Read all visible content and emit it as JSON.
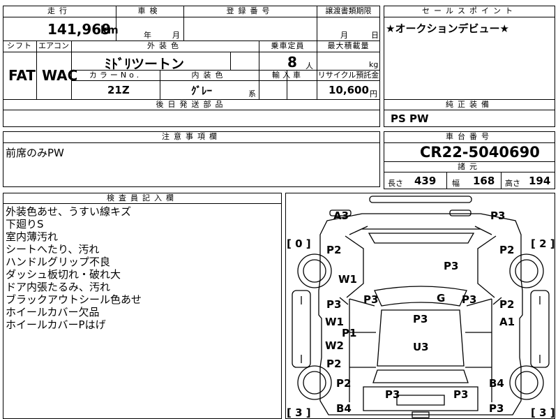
{
  "top_row": {
    "mileage_label": "走行",
    "mileage_value": "141,969",
    "mileage_unit": "km",
    "inspection_label": "車検",
    "inspection_year_unit": "年",
    "inspection_month_unit": "月",
    "registration_label": "登録番号",
    "transfer_label": "譲渡書類期限",
    "transfer_month_unit": "月",
    "transfer_day_unit": "日",
    "sales_point_label": "セールスポイント",
    "sales_point_text": "★オークションデビュー★"
  },
  "second_row": {
    "shift_label": "シフト",
    "shift_value": "FAT",
    "aircon_label": "エアコン",
    "aircon_value": "WAC",
    "exterior_color_label": "外装色",
    "exterior_color_value": "ﾐﾄﾞﾘツートン",
    "capacity_label": "乗車定員",
    "capacity_value": "8",
    "capacity_unit": "人",
    "max_load_label": "最大積載量",
    "max_load_unit": "kg",
    "color_no_label": "カラーNo.",
    "color_no_value": "21Z",
    "interior_color_label": "内装色",
    "interior_color_value": "ｸﾞﾚｰ",
    "interior_color_suffix": "系",
    "import_label": "輸入車",
    "recycle_label": "リサイクル預託金",
    "recycle_value": "10,600",
    "recycle_unit": "円",
    "later_parts_label": "後日発送部品",
    "genuine_equipment_label": "純正装備",
    "genuine_equipment_value": "PS PW"
  },
  "notes": {
    "label": "注意事項欄",
    "text": "前席のみPW"
  },
  "chassis": {
    "label": "車台番号",
    "value": "CR22-5040690",
    "specs_label": "諸元",
    "length_label": "長さ",
    "length_value": "439",
    "width_label": "幅",
    "width_value": "168",
    "height_label": "高さ",
    "height_value": "194"
  },
  "inspector": {
    "label": "検査員記入欄",
    "lines": [
      "外装色あせ、うすい線キズ",
      "下廻りS",
      "室内薄汚れ",
      "シートへたり、汚れ",
      "ハンドルグリップ不良",
      "ダッシュ板切れ・破れ大",
      "ドア内張たるみ、汚れ",
      "ブラックアウトシール色あせ",
      "ホイールカバー欠品",
      "ホイールカバーPはげ"
    ]
  },
  "diagram": {
    "brackets": {
      "left_top": "[ 0 ]",
      "right_top": "[ 2 ]",
      "left_bottom": "[ 3 ]",
      "right_bottom": "[ 3 ]"
    },
    "marks": {
      "front_left": "A3",
      "front_right": "P3",
      "fender_left": "P2",
      "fender_right": "P2",
      "hood": "P3",
      "door_left_top": "W1",
      "pillar_left": "P3",
      "glass": "G",
      "pillar_right": "P3",
      "door_left_a": "P3",
      "door_left_b": "W1",
      "door_right_a": "P2",
      "door_right_b": "A1",
      "roof": "P3",
      "roof_p1": "P1",
      "door_left_c": "W2",
      "door_left_d": "P2",
      "rear_body": "U3",
      "rear_left": "P2",
      "rear_right": "B4",
      "tail_left": "B4",
      "tail_center": "P3",
      "tail_center_left": "P3",
      "tail_right": "P3"
    }
  }
}
